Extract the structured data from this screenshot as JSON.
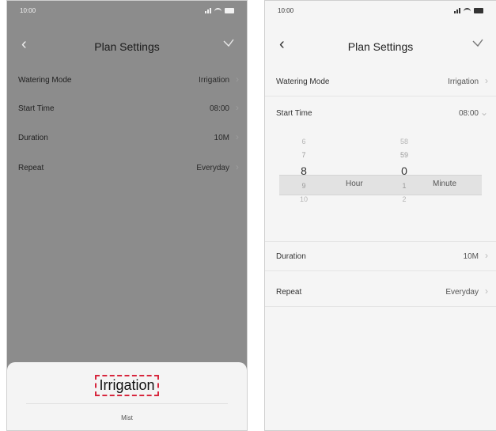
{
  "left_screen": {
    "status_time": "10:00",
    "title": "Plan Settings",
    "rows": [
      {
        "label": "Watering Mode",
        "value": "Irrigation"
      },
      {
        "label": "Start Time",
        "value": "08:00"
      },
      {
        "label": "Duration",
        "value": "10M"
      },
      {
        "label": "Repeat",
        "value": "Everyday"
      }
    ],
    "sheet": {
      "option_selected": "Irrigation",
      "option_other": "Mist"
    }
  },
  "right_screen": {
    "status_time": "10:00",
    "title": "Plan Settings",
    "rows": [
      {
        "label": "Watering Mode",
        "value": "Irrigation"
      },
      {
        "label": "Start Time",
        "value": "08:00"
      },
      {
        "label": "Duration",
        "value": "10M"
      },
      {
        "label": "Repeat",
        "value": "Everyday"
      }
    ],
    "picker": {
      "hours": [
        "6",
        "7",
        "8",
        "9",
        "10"
      ],
      "minutes": [
        "58",
        "59",
        "0",
        "1",
        "2"
      ],
      "hour_unit": "Hour",
      "minute_unit": "Minute"
    }
  },
  "colors": {
    "overlay": "#8c8c8c",
    "highlight": "#d7263d"
  }
}
